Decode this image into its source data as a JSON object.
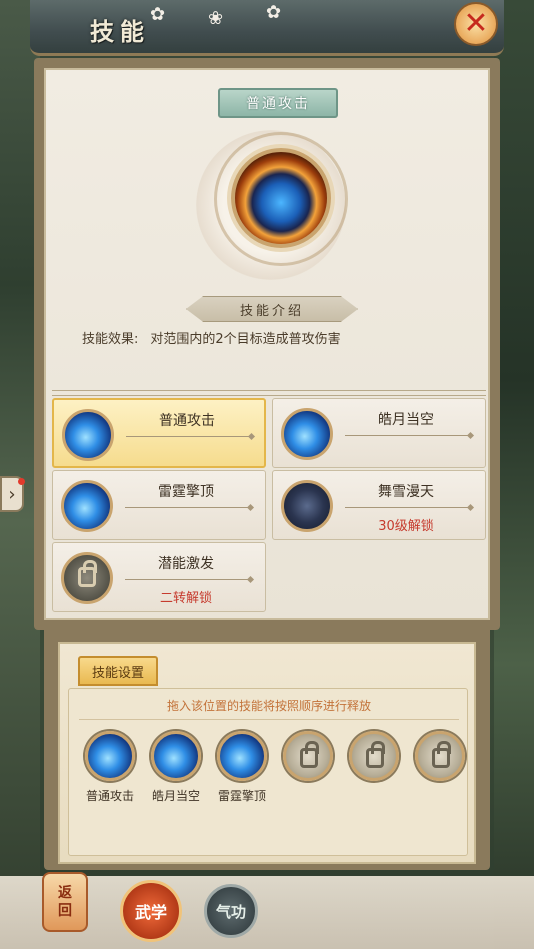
{
  "window": {
    "title": "技能",
    "close_label": "✕"
  },
  "header": {
    "skill_title": "普通攻击",
    "intro_label": "技能介绍"
  },
  "effect": {
    "label": "技能效果:",
    "text": "对范围内的2个目标造成普攻伤害"
  },
  "skills": [
    {
      "name": "普通攻击",
      "unlock": "",
      "icon": "sword-slash-icon",
      "state": "selected"
    },
    {
      "name": "皓月当空",
      "unlock": "",
      "icon": "sword-slash-icon",
      "state": "normal"
    },
    {
      "name": "雷霆擎顶",
      "unlock": "",
      "icon": "sword-slash-icon",
      "state": "normal"
    },
    {
      "name": "舞雪漫天",
      "unlock": "30级解锁",
      "icon": "dark-sword-icon",
      "state": "locked"
    },
    {
      "name": "潜能激发",
      "unlock": "二转解锁",
      "icon": "lock-icon",
      "state": "locked"
    }
  ],
  "settings": {
    "tab_label": "技能设置",
    "hint": "拖入该位置的技能将按照顺序进行释放",
    "slots": [
      {
        "label": "普通攻击",
        "icon": "sword-slash-icon"
      },
      {
        "label": "皓月当空",
        "icon": "sword-slash-icon"
      },
      {
        "label": "雷霆擎顶",
        "icon": "sword-slash-icon"
      },
      {
        "label": "",
        "icon": "lock-icon"
      },
      {
        "label": "",
        "icon": "lock-icon"
      },
      {
        "label": "",
        "icon": "lock-icon"
      }
    ]
  },
  "nav": {
    "back_label_1": "返",
    "back_label_2": "回",
    "wuxue_label": "武学",
    "qigong_label": "气功"
  },
  "side": {
    "expand_label": "›"
  }
}
